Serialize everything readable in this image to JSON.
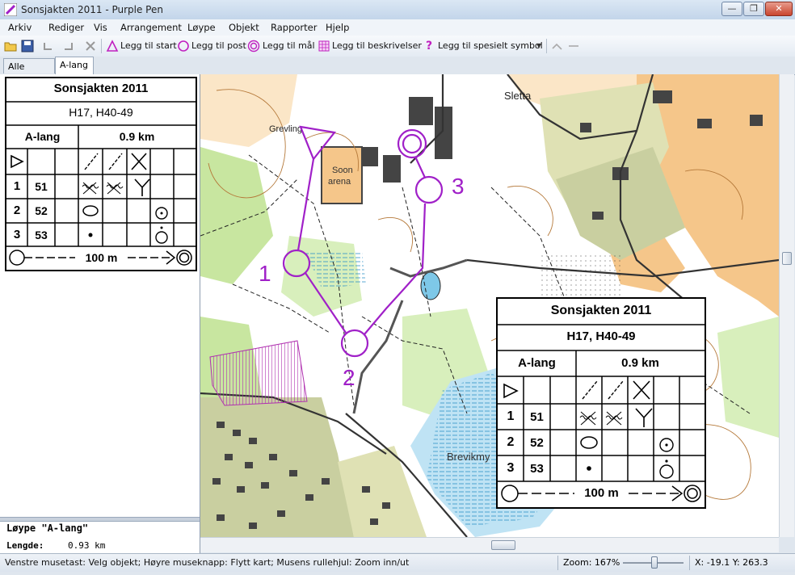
{
  "window": {
    "title": "Sonsjakten 2011 - Purple Pen",
    "minimize": "—",
    "maximize": "❐",
    "close": "✕"
  },
  "menu": [
    "Arkiv",
    "Rediger",
    "Vis",
    "Arrangement",
    "Løype",
    "Objekt",
    "Rapporter",
    "Hjelp"
  ],
  "toolbar": {
    "add_start": "Legg til start",
    "add_control": "Legg til post",
    "add_finish": "Legg til mål",
    "add_descriptions": "Legg til beskrivelser",
    "add_special": "Legg til spesielt symbol"
  },
  "tabs": [
    "Alle poster",
    "A-lang"
  ],
  "description": {
    "event": "Sonsjakten 2011",
    "classes": "H17, H40-49",
    "course": "A-lang",
    "length": "0.9 km",
    "controls": [
      {
        "seq": "1",
        "code": "51"
      },
      {
        "seq": "2",
        "code": "52"
      },
      {
        "seq": "3",
        "code": "53"
      }
    ],
    "finish_distance": "100 m"
  },
  "course_info": {
    "title": "Løype \"A-lang\"",
    "length_label": "Lengde:",
    "length_value": "0.93 km"
  },
  "map": {
    "labels": {
      "sletta": "Sletta",
      "grevling": "Grevling",
      "soon": "Soon",
      "arena": "arena",
      "brevikmy": "Brevikmy"
    },
    "control_numbers": [
      "1",
      "2",
      "3"
    ]
  },
  "status": {
    "message": "Venstre musetast: Velg objekt; Høyre museknapp: Flytt kart; Musens rullehjul: Zoom inn/ut",
    "zoom": "Zoom: 167%",
    "zoom_percent": 167,
    "coords": "X: -19.1   Y: 263.3"
  },
  "colors": {
    "course": "#a020c8",
    "forest": "#ffffff",
    "open": "#f5c68a",
    "green": "#c8e6a0",
    "water": "#7ec8e8",
    "road": "#333333"
  }
}
